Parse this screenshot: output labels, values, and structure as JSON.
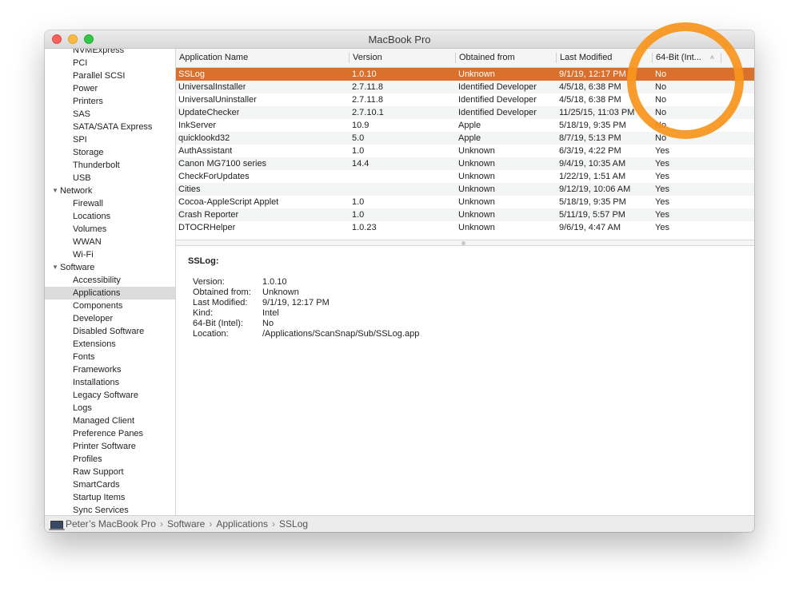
{
  "window": {
    "title": "MacBook Pro"
  },
  "sidebar": [
    {
      "label": "NVMExpress",
      "type": "child"
    },
    {
      "label": "PCI",
      "type": "child"
    },
    {
      "label": "Parallel SCSI",
      "type": "child"
    },
    {
      "label": "Power",
      "type": "child"
    },
    {
      "label": "Printers",
      "type": "child"
    },
    {
      "label": "SAS",
      "type": "child"
    },
    {
      "label": "SATA/SATA Express",
      "type": "child"
    },
    {
      "label": "SPI",
      "type": "child"
    },
    {
      "label": "Storage",
      "type": "child"
    },
    {
      "label": "Thunderbolt",
      "type": "child"
    },
    {
      "label": "USB",
      "type": "child"
    },
    {
      "label": "Network",
      "type": "section"
    },
    {
      "label": "Firewall",
      "type": "child"
    },
    {
      "label": "Locations",
      "type": "child"
    },
    {
      "label": "Volumes",
      "type": "child"
    },
    {
      "label": "WWAN",
      "type": "child"
    },
    {
      "label": "Wi-Fi",
      "type": "child"
    },
    {
      "label": "Software",
      "type": "section"
    },
    {
      "label": "Accessibility",
      "type": "child"
    },
    {
      "label": "Applications",
      "type": "child",
      "selected": true
    },
    {
      "label": "Components",
      "type": "child"
    },
    {
      "label": "Developer",
      "type": "child"
    },
    {
      "label": "Disabled Software",
      "type": "child"
    },
    {
      "label": "Extensions",
      "type": "child"
    },
    {
      "label": "Fonts",
      "type": "child"
    },
    {
      "label": "Frameworks",
      "type": "child"
    },
    {
      "label": "Installations",
      "type": "child"
    },
    {
      "label": "Legacy Software",
      "type": "child"
    },
    {
      "label": "Logs",
      "type": "child"
    },
    {
      "label": "Managed Client",
      "type": "child"
    },
    {
      "label": "Preference Panes",
      "type": "child"
    },
    {
      "label": "Printer Software",
      "type": "child"
    },
    {
      "label": "Profiles",
      "type": "child"
    },
    {
      "label": "Raw Support",
      "type": "child"
    },
    {
      "label": "SmartCards",
      "type": "child"
    },
    {
      "label": "Startup Items",
      "type": "child"
    },
    {
      "label": "Sync Services",
      "type": "child"
    }
  ],
  "table": {
    "columns": [
      "Application Name",
      "Version",
      "Obtained from",
      "Last Modified",
      "64-Bit (Int..."
    ],
    "sort_icon": "chevron-up-icon",
    "rows": [
      [
        "SSLog",
        "1.0.10",
        "Unknown",
        "9/1/19, 12:17 PM",
        "No"
      ],
      [
        "UniversalInstaller",
        "2.7.11.8",
        "Identified Developer",
        "4/5/18, 6:38 PM",
        "No"
      ],
      [
        "UniversalUninstaller",
        "2.7.11.8",
        "Identified Developer",
        "4/5/18, 6:38 PM",
        "No"
      ],
      [
        "UpdateChecker",
        "2.7.10.1",
        "Identified Developer",
        "11/25/15, 11:03 PM",
        "No"
      ],
      [
        "InkServer",
        "10.9",
        "Apple",
        "5/18/19, 9:35 PM",
        "No"
      ],
      [
        "quicklookd32",
        "5.0",
        "Apple",
        "8/7/19, 5:13 PM",
        "No"
      ],
      [
        "AuthAssistant",
        "1.0",
        "Unknown",
        "6/3/19, 4:22 PM",
        "Yes"
      ],
      [
        "Canon MG7100 series",
        "14.4",
        "Unknown",
        "9/4/19, 10:35 AM",
        "Yes"
      ],
      [
        "CheckForUpdates",
        "",
        "Unknown",
        "1/22/19, 1:51 AM",
        "Yes"
      ],
      [
        "Cities",
        "",
        "Unknown",
        "9/12/19, 10:06 AM",
        "Yes"
      ],
      [
        "Cocoa-AppleScript Applet",
        "1.0",
        "Unknown",
        "5/18/19, 9:35 PM",
        "Yes"
      ],
      [
        "Crash Reporter",
        "1.0",
        "Unknown",
        "5/11/19, 5:57 PM",
        "Yes"
      ],
      [
        "DTOCRHelper",
        "1.0.23",
        "Unknown",
        "9/6/19, 4:47 AM",
        "Yes"
      ]
    ],
    "selected_row": 0
  },
  "detail": {
    "title": "SSLog:",
    "fields": [
      {
        "key": "Version:",
        "value": "1.0.10"
      },
      {
        "key": "Obtained from:",
        "value": "Unknown"
      },
      {
        "key": "Last Modified:",
        "value": "9/1/19, 12:17 PM"
      },
      {
        "key": "Kind:",
        "value": "Intel"
      },
      {
        "key": "64-Bit (Intel):",
        "value": "No"
      },
      {
        "key": "Location:",
        "value": "/Applications/ScanSnap/Sub/SSLog.app"
      }
    ]
  },
  "pathbar": {
    "icon": "laptop-icon",
    "crumbs": [
      "Peter’s MacBook Pro",
      "Software",
      "Applications",
      "SSLog"
    ]
  },
  "annotation": {
    "color": "#f7961d"
  }
}
